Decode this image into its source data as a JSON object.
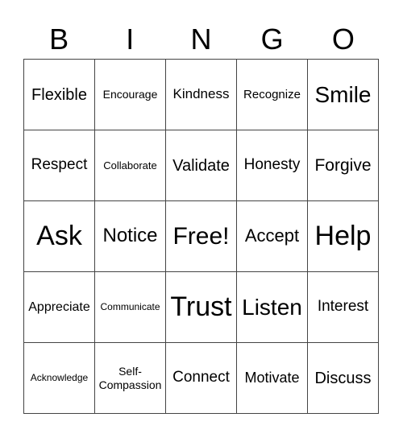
{
  "header": {
    "letters": [
      "B",
      "I",
      "N",
      "G",
      "O"
    ]
  },
  "cells": [
    {
      "text": "Flexible",
      "size": 20
    },
    {
      "text": "Encourage",
      "size": 14
    },
    {
      "text": "Kindness",
      "size": 17
    },
    {
      "text": "Recognize",
      "size": 15
    },
    {
      "text": "Smile",
      "size": 28
    },
    {
      "text": "Respect",
      "size": 19
    },
    {
      "text": "Collaborate",
      "size": 13
    },
    {
      "text": "Validate",
      "size": 20
    },
    {
      "text": "Honesty",
      "size": 19
    },
    {
      "text": "Forgive",
      "size": 21
    },
    {
      "text": "Ask",
      "size": 34
    },
    {
      "text": "Notice",
      "size": 24
    },
    {
      "text": "Free!",
      "size": 30
    },
    {
      "text": "Accept",
      "size": 22
    },
    {
      "text": "Help",
      "size": 34
    },
    {
      "text": "Appreciate",
      "size": 16
    },
    {
      "text": "Communicate",
      "size": 12
    },
    {
      "text": "Trust",
      "size": 34
    },
    {
      "text": "Listen",
      "size": 28
    },
    {
      "text": "Interest",
      "size": 19
    },
    {
      "text": "Acknowledge",
      "size": 12
    },
    {
      "text": "Self-\nCompassion",
      "size": 14
    },
    {
      "text": "Connect",
      "size": 19
    },
    {
      "text": "Motivate",
      "size": 18
    },
    {
      "text": "Discuss",
      "size": 20
    }
  ]
}
